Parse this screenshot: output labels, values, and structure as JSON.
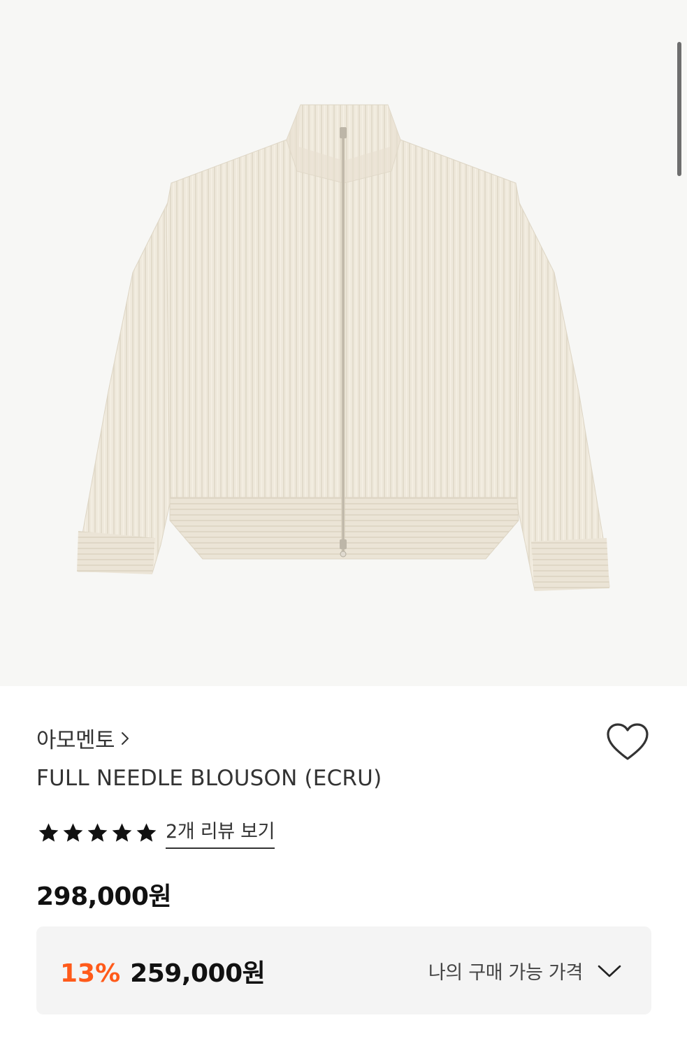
{
  "product": {
    "image_alt": "ecru ribbed knit full-zip blouson",
    "brand": "아모멘토",
    "title": "FULL NEEDLE BLOUSON (ECRU)",
    "rating_stars": 5,
    "review_link": "2개 리뷰 보기",
    "original_price": "298,000원",
    "discount_rate": "13%",
    "sale_price": "259,000원",
    "my_price_label": "나의 구매 가능 가격"
  },
  "icons": {
    "brand_chevron": "chevron-right-icon",
    "wishlist": "heart-outline-icon",
    "star": "star-icon",
    "expand": "chevron-down-icon"
  },
  "colors": {
    "discount": "#ff5a1a",
    "image_bg": "#f7f7f5",
    "garment": "#efe9dc",
    "price_box_bg": "#f4f4f4"
  }
}
